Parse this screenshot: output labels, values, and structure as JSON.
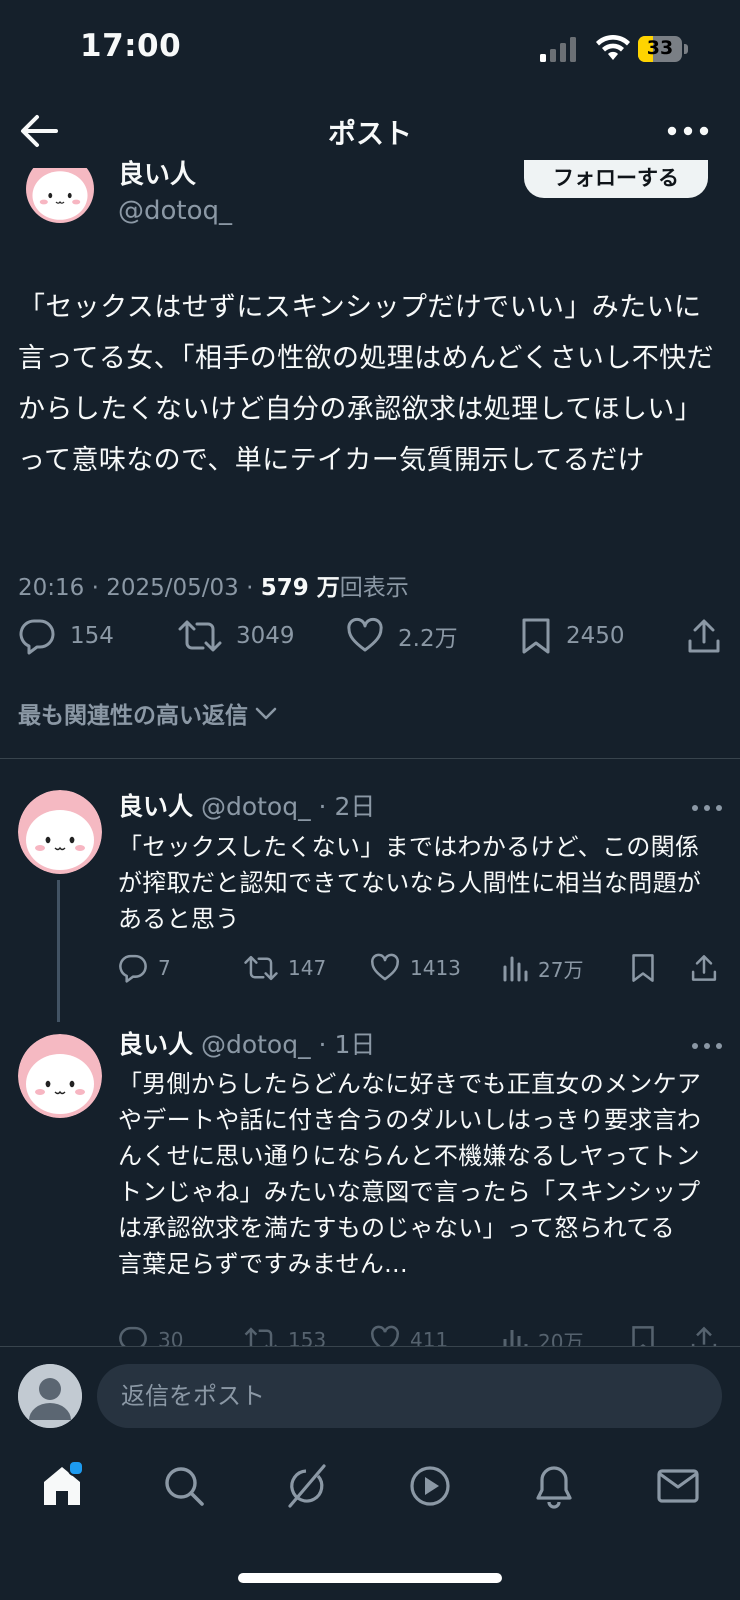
{
  "status_bar": {
    "time": "17:00",
    "battery": "33",
    "battery_level": 0.33
  },
  "header": {
    "title": "ポスト"
  },
  "post": {
    "author_name": "良い人",
    "author_handle": "@dotoq_",
    "follow_label": "フォローする",
    "text": "「セックスはせずにスキンシップだけでいい」みたいに言ってる女、「相手の性欲の処理はめんどくさいし不快だからしたくないけど自分の承認欲求は処理してほしい」って意味なので、単にテイカー気質開示してるだけ",
    "time": "20:16",
    "date": "2025/05/03",
    "views": "579 万",
    "views_label": "回表示",
    "replies": "154",
    "reposts": "3049",
    "likes": "2.2万",
    "bookmarks": "2450"
  },
  "relevance_label": "最も関連性の高い返信",
  "replies": [
    {
      "name": "良い人",
      "handle": "@dotoq_",
      "time": "2日",
      "text": "「セックスしたくない」まではわかるけど、この関係が搾取だと認知できてないなら人間性に相当な問題があると思う",
      "replies": "7",
      "reposts": "147",
      "likes": "1413",
      "views": "27万"
    },
    {
      "name": "良い人",
      "handle": "@dotoq_",
      "time": "1日",
      "text": "「男側からしたらどんなに好きでも正直女のメンケアやデートや話に付き合うのダルいしはっきり要求言わんくせに思い通りにならんと不機嫌なるしヤってトントンじゃね」みたいな意図で言ったら「スキンシップは承認欲求を満たすものじゃない」って怒られてる\n言葉足らずですみません...",
      "replies": "30",
      "reposts": "153",
      "likes": "411",
      "views": "20万"
    }
  ],
  "composer": {
    "placeholder": "返信をポスト"
  },
  "tabbar": [
    "home-icon",
    "search-icon",
    "grok-icon",
    "video-icon",
    "notifications-icon",
    "messages-icon"
  ]
}
